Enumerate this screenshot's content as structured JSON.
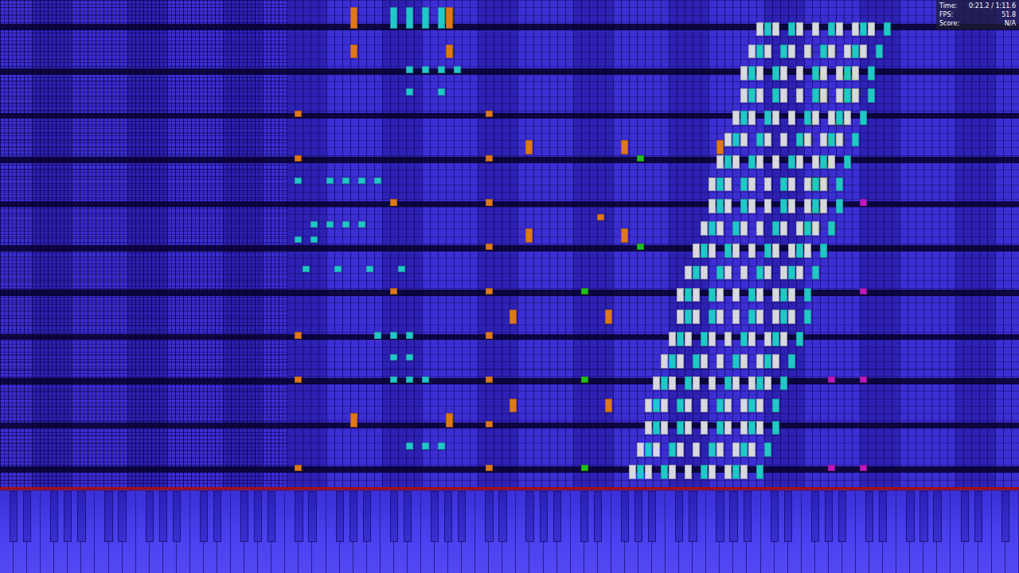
{
  "hud": [
    {
      "label": "Time:",
      "value": "0:21.2 / 1:11.6"
    },
    {
      "label": "FPS:",
      "value": "51.8"
    },
    {
      "label": "Score:",
      "value": "N/A"
    }
  ],
  "roll": {
    "rows": 66,
    "key_count": 128
  },
  "keyboard": {
    "white_keys": 75
  },
  "notes": [
    {
      "t": 1,
      "d": 2,
      "keys": [
        79,
        81,
        84,
        86,
        89,
        91,
        93
      ],
      "color": "#d8d8e0"
    },
    {
      "t": 1,
      "d": 2,
      "keys": [
        80,
        83,
        88,
        92,
        95
      ],
      "color": "#20c8c8"
    },
    {
      "t": 4,
      "d": 2,
      "keys": [
        80,
        82,
        85,
        87,
        90,
        92,
        94
      ],
      "color": "#d8d8e0"
    },
    {
      "t": 4,
      "d": 2,
      "keys": [
        81,
        84,
        89,
        93,
        96
      ],
      "color": "#20c8c8"
    },
    {
      "t": 7,
      "d": 2,
      "keys": [
        81,
        83,
        86,
        88,
        91,
        93,
        95
      ],
      "color": "#d8d8e0"
    },
    {
      "t": 7,
      "d": 2,
      "keys": [
        82,
        85,
        90,
        94,
        97
      ],
      "color": "#20c8c8"
    },
    {
      "t": 10,
      "d": 2,
      "keys": [
        81,
        83,
        86,
        88,
        91,
        93,
        95
      ],
      "color": "#d8d8e0"
    },
    {
      "t": 10,
      "d": 2,
      "keys": [
        82,
        85,
        90,
        94,
        97
      ],
      "color": "#20c8c8"
    },
    {
      "t": 13,
      "d": 2,
      "keys": [
        82,
        84,
        87,
        89,
        92,
        94,
        96
      ],
      "color": "#d8d8e0"
    },
    {
      "t": 13,
      "d": 2,
      "keys": [
        83,
        86,
        91,
        95,
        98
      ],
      "color": "#20c8c8"
    },
    {
      "t": 16,
      "d": 2,
      "keys": [
        83,
        85,
        88,
        90,
        93,
        95,
        97
      ],
      "color": "#d8d8e0"
    },
    {
      "t": 16,
      "d": 2,
      "keys": [
        84,
        87,
        92,
        96,
        99
      ],
      "color": "#20c8c8"
    },
    {
      "t": 19,
      "d": 2,
      "keys": [
        84,
        86,
        89,
        91,
        94,
        96,
        98
      ],
      "color": "#d8d8e0"
    },
    {
      "t": 19,
      "d": 2,
      "keys": [
        85,
        88,
        93,
        97,
        100
      ],
      "color": "#20c8c8"
    },
    {
      "t": 22,
      "d": 2,
      "keys": [
        85,
        87,
        90,
        92,
        95,
        97,
        99
      ],
      "color": "#d8d8e0"
    },
    {
      "t": 22,
      "d": 2,
      "keys": [
        86,
        89,
        94,
        98,
        101
      ],
      "color": "#20c8c8"
    },
    {
      "t": 25,
      "d": 2,
      "keys": [
        85,
        87,
        90,
        92,
        95,
        97,
        99
      ],
      "color": "#d8d8e0"
    },
    {
      "t": 25,
      "d": 2,
      "keys": [
        86,
        89,
        94,
        98,
        101
      ],
      "color": "#20c8c8"
    },
    {
      "t": 28,
      "d": 2,
      "keys": [
        86,
        88,
        91,
        93,
        96,
        98,
        100
      ],
      "color": "#d8d8e0"
    },
    {
      "t": 28,
      "d": 2,
      "keys": [
        87,
        90,
        95,
        99,
        102
      ],
      "color": "#20c8c8"
    },
    {
      "t": 31,
      "d": 2,
      "keys": [
        87,
        89,
        92,
        94,
        97,
        99,
        101
      ],
      "color": "#d8d8e0"
    },
    {
      "t": 31,
      "d": 2,
      "keys": [
        88,
        91,
        96,
        100,
        103
      ],
      "color": "#20c8c8"
    },
    {
      "t": 34,
      "d": 2,
      "keys": [
        88,
        90,
        93,
        95,
        98,
        100,
        102
      ],
      "color": "#d8d8e0"
    },
    {
      "t": 34,
      "d": 2,
      "keys": [
        89,
        92,
        97,
        101,
        104
      ],
      "color": "#20c8c8"
    },
    {
      "t": 37,
      "d": 2,
      "keys": [
        89,
        91,
        94,
        96,
        99,
        101,
        103
      ],
      "color": "#d8d8e0"
    },
    {
      "t": 37,
      "d": 2,
      "keys": [
        90,
        93,
        98,
        102,
        105
      ],
      "color": "#20c8c8"
    },
    {
      "t": 40,
      "d": 2,
      "keys": [
        89,
        91,
        94,
        96,
        99,
        101,
        103
      ],
      "color": "#d8d8e0"
    },
    {
      "t": 40,
      "d": 2,
      "keys": [
        90,
        93,
        98,
        102,
        105
      ],
      "color": "#20c8c8"
    },
    {
      "t": 43,
      "d": 2,
      "keys": [
        90,
        92,
        95,
        97,
        100,
        102,
        104
      ],
      "color": "#d8d8e0"
    },
    {
      "t": 43,
      "d": 2,
      "keys": [
        91,
        94,
        99,
        103,
        106
      ],
      "color": "#20c8c8"
    },
    {
      "t": 46,
      "d": 2,
      "keys": [
        91,
        93,
        96,
        98,
        101,
        103,
        105
      ],
      "color": "#d8d8e0"
    },
    {
      "t": 46,
      "d": 2,
      "keys": [
        92,
        95,
        100,
        104,
        107
      ],
      "color": "#20c8c8"
    },
    {
      "t": 49,
      "d": 2,
      "keys": [
        92,
        94,
        97,
        99,
        102,
        104,
        106
      ],
      "color": "#d8d8e0"
    },
    {
      "t": 49,
      "d": 2,
      "keys": [
        93,
        96,
        101,
        105,
        108
      ],
      "color": "#20c8c8"
    },
    {
      "t": 52,
      "d": 2,
      "keys": [
        93,
        95,
        98,
        100,
        103,
        105,
        107
      ],
      "color": "#d8d8e0"
    },
    {
      "t": 52,
      "d": 2,
      "keys": [
        94,
        97,
        102,
        106,
        109
      ],
      "color": "#20c8c8"
    },
    {
      "t": 55,
      "d": 2,
      "keys": [
        93,
        95,
        98,
        100,
        103,
        105,
        107
      ],
      "color": "#d8d8e0"
    },
    {
      "t": 55,
      "d": 2,
      "keys": [
        94,
        97,
        102,
        106,
        109
      ],
      "color": "#20c8c8"
    },
    {
      "t": 58,
      "d": 2,
      "keys": [
        94,
        96,
        99,
        101,
        104,
        106,
        108
      ],
      "color": "#d8d8e0"
    },
    {
      "t": 58,
      "d": 2,
      "keys": [
        95,
        98,
        103,
        107,
        110
      ],
      "color": "#20c8c8"
    },
    {
      "t": 61,
      "d": 2,
      "keys": [
        95,
        97,
        100,
        102,
        105,
        107,
        109
      ],
      "color": "#d8d8e0"
    },
    {
      "t": 61,
      "d": 2,
      "keys": [
        96,
        99,
        104,
        108,
        111
      ],
      "color": "#20c8c8"
    },
    {
      "t": 50,
      "d": 1,
      "keys": [
        37,
        61
      ],
      "color": "#e07818"
    },
    {
      "t": 44,
      "d": 1,
      "keys": [
        37,
        61
      ],
      "color": "#e07818"
    },
    {
      "t": 38,
      "d": 1,
      "keys": [
        61
      ],
      "color": "#e07818"
    },
    {
      "t": 32,
      "d": 1,
      "keys": [
        61
      ],
      "color": "#e07818"
    },
    {
      "t": 26,
      "d": 1,
      "keys": [
        61
      ],
      "color": "#e07818"
    },
    {
      "t": 20,
      "d": 1,
      "keys": [
        37,
        61
      ],
      "color": "#e07818"
    },
    {
      "t": 14,
      "d": 1,
      "keys": [
        37,
        61
      ],
      "color": "#e07818"
    },
    {
      "t": 8,
      "d": 1,
      "keys": [
        61
      ],
      "color": "#e07818"
    },
    {
      "t": 2,
      "d": 1,
      "keys": [
        37,
        61
      ],
      "color": "#e07818"
    },
    {
      "t": 58,
      "d": 2,
      "keys": [
        44,
        56
      ],
      "color": "#e07818"
    },
    {
      "t": 8,
      "d": 2,
      "keys": [
        44,
        56
      ],
      "color": "#e07818"
    },
    {
      "t": 45,
      "d": 2,
      "keys": [
        66,
        78,
        90
      ],
      "color": "#e07818"
    },
    {
      "t": 33,
      "d": 2,
      "keys": [
        66,
        78
      ],
      "color": "#e07818"
    },
    {
      "t": 22,
      "d": 2,
      "keys": [
        64,
        76
      ],
      "color": "#e07818"
    },
    {
      "t": 10,
      "d": 2,
      "keys": [
        64,
        76
      ],
      "color": "#e07818"
    },
    {
      "t": 38,
      "d": 1,
      "keys": [
        49
      ],
      "color": "#e07818"
    },
    {
      "t": 26,
      "d": 1,
      "keys": [
        49
      ],
      "color": "#e07818"
    },
    {
      "t": 36,
      "d": 1,
      "keys": [
        75
      ],
      "color": "#e07818"
    },
    {
      "t": 62,
      "d": 3,
      "keys": [
        44,
        56
      ],
      "color": "#e07818"
    },
    {
      "t": 62,
      "d": 3,
      "keys": [
        49,
        51,
        53,
        55
      ],
      "color": "#20c8c8"
    },
    {
      "t": 56,
      "d": 1,
      "keys": [
        51,
        53,
        55,
        57
      ],
      "color": "#20c8c8"
    },
    {
      "t": 53,
      "d": 1,
      "keys": [
        51,
        55
      ],
      "color": "#20c8c8"
    },
    {
      "t": 41,
      "d": 1,
      "keys": [
        37,
        41,
        43,
        45,
        47
      ],
      "color": "#20c8c8"
    },
    {
      "t": 35,
      "d": 1,
      "keys": [
        39,
        41,
        43,
        45
      ],
      "color": "#20c8c8"
    },
    {
      "t": 33,
      "d": 1,
      "keys": [
        37,
        39
      ],
      "color": "#20c8c8"
    },
    {
      "t": 29,
      "d": 1,
      "keys": [
        38,
        42,
        46,
        50
      ],
      "color": "#20c8c8"
    },
    {
      "t": 20,
      "d": 1,
      "keys": [
        47,
        49,
        51
      ],
      "color": "#20c8c8"
    },
    {
      "t": 17,
      "d": 1,
      "keys": [
        49,
        51
      ],
      "color": "#20c8c8"
    },
    {
      "t": 14,
      "d": 1,
      "keys": [
        49,
        51,
        53
      ],
      "color": "#20c8c8"
    },
    {
      "t": 5,
      "d": 1,
      "keys": [
        51,
        53,
        55
      ],
      "color": "#20c8c8"
    },
    {
      "t": 26,
      "d": 1,
      "keys": [
        73
      ],
      "color": "#20c020"
    },
    {
      "t": 14,
      "d": 1,
      "keys": [
        73
      ],
      "color": "#20c020"
    },
    {
      "t": 2,
      "d": 1,
      "keys": [
        73
      ],
      "color": "#20c020"
    },
    {
      "t": 44,
      "d": 1,
      "keys": [
        80
      ],
      "color": "#20c020"
    },
    {
      "t": 32,
      "d": 1,
      "keys": [
        80
      ],
      "color": "#20c020"
    },
    {
      "t": 38,
      "d": 1,
      "keys": [
        108
      ],
      "color": "#c018c0"
    },
    {
      "t": 26,
      "d": 1,
      "keys": [
        108
      ],
      "color": "#c018c0"
    },
    {
      "t": 14,
      "d": 1,
      "keys": [
        104,
        108
      ],
      "color": "#c018c0"
    },
    {
      "t": 2,
      "d": 1,
      "keys": [
        104,
        108
      ],
      "color": "#c018c0"
    }
  ]
}
